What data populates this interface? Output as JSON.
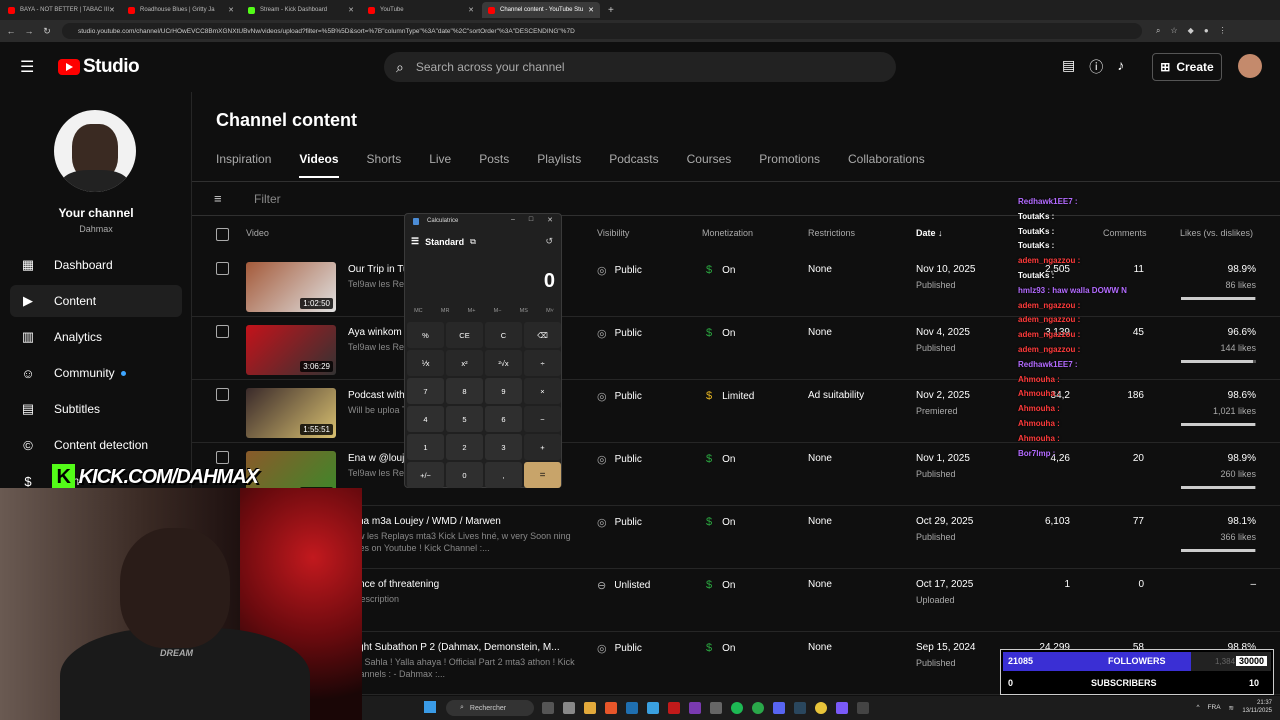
{
  "browser": {
    "tabs": [
      {
        "label": "BAYA - NOT BETTER | TABAC III",
        "color": "#ff0000"
      },
      {
        "label": "Roadhouse Blues | Gritty Ja",
        "color": "#ff0000"
      },
      {
        "label": "Stream - Kick Dashboard",
        "color": "#53fc18"
      },
      {
        "label": "YouTube",
        "color": "#ff0000"
      },
      {
        "label": "Channel content - YouTube Stu",
        "color": "#ff0000"
      }
    ],
    "url": "studio.youtube.com/channel/UCrHOwEVCC8BmXGNXtUBvNw/videos/upload?filter=%5B%5D&sort=%7B\"columnType\"%3A\"date\"%2C\"sortOrder\"%3A\"DESCENDING\"%7D"
  },
  "header": {
    "logo_text": "Studio",
    "search_placeholder": "Search across your channel",
    "create_label": "Create"
  },
  "sidebar": {
    "your_channel": "Your channel",
    "handle": "Dahmax",
    "items": [
      {
        "label": "Dashboard",
        "icon": "dashboard-icon",
        "glyph": "▦"
      },
      {
        "label": "Content",
        "icon": "content-icon",
        "glyph": "▶"
      },
      {
        "label": "Analytics",
        "icon": "analytics-icon",
        "glyph": "▥"
      },
      {
        "label": "Community",
        "icon": "community-icon",
        "glyph": "☺"
      },
      {
        "label": "Subtitles",
        "icon": "subtitles-icon",
        "glyph": "▤"
      },
      {
        "label": "Content detection",
        "icon": "copyright-icon",
        "glyph": "©"
      },
      {
        "label": "Earn",
        "icon": "earn-icon",
        "glyph": "$"
      }
    ]
  },
  "main": {
    "title": "Channel content",
    "tabs": [
      "Inspiration",
      "Videos",
      "Shorts",
      "Live",
      "Posts",
      "Playlists",
      "Podcasts",
      "Courses",
      "Promotions",
      "Collaborations"
    ],
    "active_tab": "Videos",
    "filter_placeholder": "Filter",
    "columns": {
      "video": "Video",
      "visibility": "Visibility",
      "monetization": "Monetization",
      "restrictions": "Restrictions",
      "date": "Date ↓",
      "views": "Views",
      "comments": "Comments",
      "likes": "Likes (vs. dislikes)"
    },
    "rows": [
      {
        "title": "Our Trip in Tu",
        "desc": "Tel9aw les Re Gaming Lives",
        "duration": "1:02:50",
        "visibility": "Public",
        "vis_icon": "◎",
        "monetization": "On",
        "mon_color": "#2ba640",
        "restrictions": "None",
        "date": "Nov 10, 2025",
        "date_status": "Published",
        "views": "2,505",
        "comments": "11",
        "likes": "98.9%",
        "likes_count": "86 likes",
        "like_ratio": 0.989
      },
      {
        "title": "Aya winkom",
        "desc": "Tel9aw les Re Gaming Lives",
        "duration": "3:06:29",
        "visibility": "Public",
        "vis_icon": "◎",
        "monetization": "On",
        "mon_color": "#2ba640",
        "restrictions": "None",
        "date": "Nov 4, 2025",
        "date_status": "Published",
        "views": "3,139",
        "comments": "45",
        "likes": "96.6%",
        "likes_count": "144 likes",
        "like_ratio": 0.966
      },
      {
        "title": "Podcast with",
        "desc": "Will be uploa Tel9aw les R",
        "duration": "1:55:51",
        "visibility": "Public",
        "vis_icon": "◎",
        "monetization": "Limited",
        "mon_color": "#e6b422",
        "restrictions": "Ad suitability",
        "date": "Nov 2, 2025",
        "date_status": "Premiered",
        "views": "34,2",
        "comments": "186",
        "likes": "98.6%",
        "likes_count": "1,021 likes",
        "like_ratio": 0.986
      },
      {
        "title": "Ena w @louj",
        "desc": "Tel9aw les Re Gaming Lives",
        "duration": "3:03:53",
        "visibility": "Public",
        "vis_icon": "◎",
        "monetization": "On",
        "mon_color": "#2ba640",
        "restrictions": "None",
        "date": "Nov 1, 2025",
        "date_status": "Published",
        "views": "4,26",
        "comments": "20",
        "likes": "98.9%",
        "likes_count": "260 likes",
        "like_ratio": 0.989
      },
      {
        "title": "kcha m3a Loujey / WMD / Marwen",
        "desc": "9aw les Replays mta3 Kick Lives hné, w very Soon ning Lives on Youtube ! Kick Channel :...",
        "duration": "",
        "visibility": "Public",
        "vis_icon": "◎",
        "monetization": "On",
        "mon_color": "#2ba640",
        "restrictions": "None",
        "date": "Oct 29, 2025",
        "date_status": "Published",
        "views": "6,103",
        "comments": "77",
        "likes": "98.1%",
        "likes_count": "366 likes",
        "like_ratio": 0.981
      },
      {
        "title": "dence of threatening",
        "desc": "d description",
        "duration": "",
        "visibility": "Unlisted",
        "vis_icon": "⊖",
        "monetization": "On",
        "mon_color": "#2ba640",
        "restrictions": "None",
        "date": "Oct 17, 2025",
        "date_status": "Uploaded",
        "views": "1",
        "comments": "0",
        "likes": "–",
        "likes_count": "",
        "like_ratio": 0
      },
      {
        "title": "hlight Subathon P 2 (Dahmax, Demonstein, M...",
        "desc": "a w Sahla ! Yalla ahaya ! Official Part 2 mta3 athon ! Kick Channels : - Dahmax :...",
        "duration": "",
        "visibility": "Public",
        "vis_icon": "◎",
        "monetization": "On",
        "mon_color": "#2ba640",
        "restrictions": "None",
        "date": "Sep 15, 2024",
        "date_status": "Published",
        "views": "24,299",
        "comments": "58",
        "likes": "98.8%",
        "likes_count": "",
        "like_ratio": 0.988
      }
    ]
  },
  "calculator": {
    "title": "Calculatrice",
    "mode": "Standard",
    "display": "0",
    "memory": [
      "MC",
      "MR",
      "M+",
      "M−",
      "MS",
      "M˅"
    ],
    "keys": [
      "%",
      "CE",
      "C",
      "⌫",
      "⅟x",
      "x²",
      "²√x",
      "÷",
      "7",
      "8",
      "9",
      "×",
      "4",
      "5",
      "6",
      "−",
      "1",
      "2",
      "3",
      "+",
      "+/−",
      "0",
      ",",
      "="
    ]
  },
  "chat": [
    {
      "user": "Redhawk1EE7 :",
      "color": "#b36bff"
    },
    {
      "user": "ToutaKs :",
      "color": "#ffffff"
    },
    {
      "user": "ToutaKs :",
      "color": "#ffffff"
    },
    {
      "user": "ToutaKs :",
      "color": "#ffffff"
    },
    {
      "user": "adem_ngazzou :",
      "color": "#ff3b3b"
    },
    {
      "user": "ToutaKs :",
      "color": "#ffffff"
    },
    {
      "user": "hmlz93 : haw walla DOWW N",
      "color": "#b36bff"
    },
    {
      "user": "adem_ngazzou :",
      "color": "#ff3b3b"
    },
    {
      "user": "adem_ngazzou :",
      "color": "#ff3b3b"
    },
    {
      "user": "adem_ngazzou :",
      "color": "#ff3b3b"
    },
    {
      "user": "adem_ngazzou :",
      "color": "#ff3b3b"
    },
    {
      "user": "Redhawk1EE7 :",
      "color": "#b36bff"
    },
    {
      "user": "Ahmouha :",
      "color": "#ff3b3b"
    },
    {
      "user": "Ahmouha :",
      "color": "#ff3b3b"
    },
    {
      "user": "Ahmouha :",
      "color": "#ff3b3b"
    },
    {
      "user": "Ahmouha :",
      "color": "#ff3b3b"
    },
    {
      "user": "Ahmouha :",
      "color": "#ff3b3b"
    },
    {
      "user": "Bor7lmp :",
      "color": "#b36bff"
    }
  ],
  "overlay": {
    "kick_text": "KICK.COM/DAHMAX",
    "kick_letter": "K",
    "shirt_text": "DREAM",
    "followers_count": "21085",
    "followers_label": "FOLLOWERS",
    "followers_ghost": "1,384",
    "followers_goal": "30000",
    "followers_ratio": 0.7,
    "subscribers_count": "0",
    "subscribers_label": "SUBSCRIBERS",
    "subscribers_goal": "10"
  },
  "taskbar": {
    "search": "Rechercher",
    "lang": "FRA",
    "time": "21:37",
    "date": "13/11/2025"
  }
}
